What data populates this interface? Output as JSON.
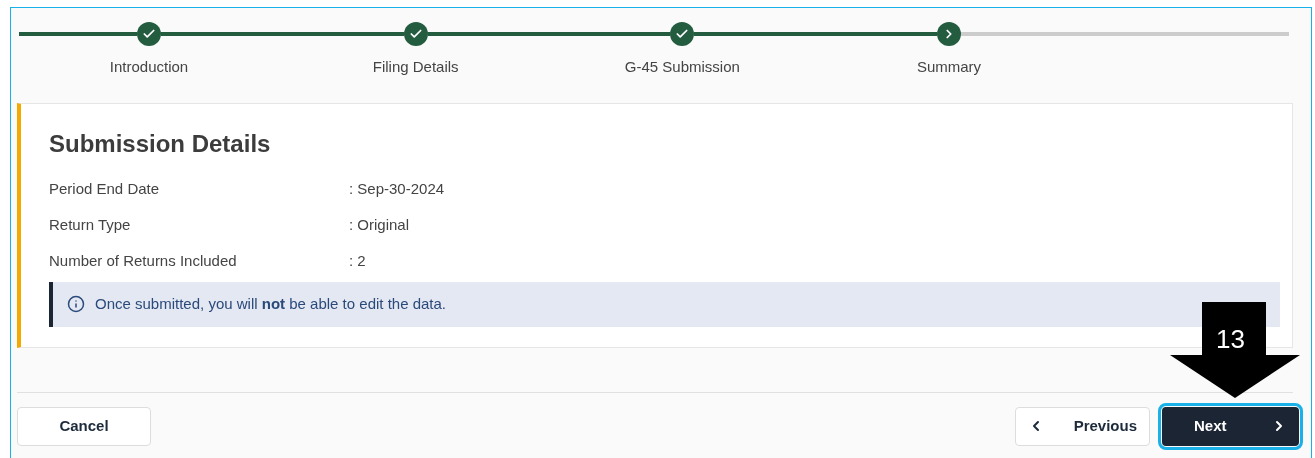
{
  "stepper": [
    {
      "label": "Introduction",
      "completed": true
    },
    {
      "label": "Filing Details",
      "completed": true
    },
    {
      "label": "G-45 Submission",
      "completed": true
    },
    {
      "label": "Summary",
      "completed": false
    }
  ],
  "card": {
    "title": "Submission Details",
    "fields": [
      {
        "label": "Period End Date",
        "value": ": Sep-30-2024"
      },
      {
        "label": "Return Type",
        "value": ": Original"
      },
      {
        "label": "Number of Returns Included",
        "value": ": 2"
      }
    ],
    "notice": "Once submitted, you will **not** be able to edit the data."
  },
  "footer": {
    "buttons": [
      {
        "label": "Cancel",
        "kind": "cancel",
        "focused": false
      },
      {
        "label": "Previous",
        "kind": "previous",
        "focused": false
      },
      {
        "label": "Next",
        "kind": "next",
        "focused": true
      }
    ]
  },
  "callout": {
    "label": "13"
  }
}
